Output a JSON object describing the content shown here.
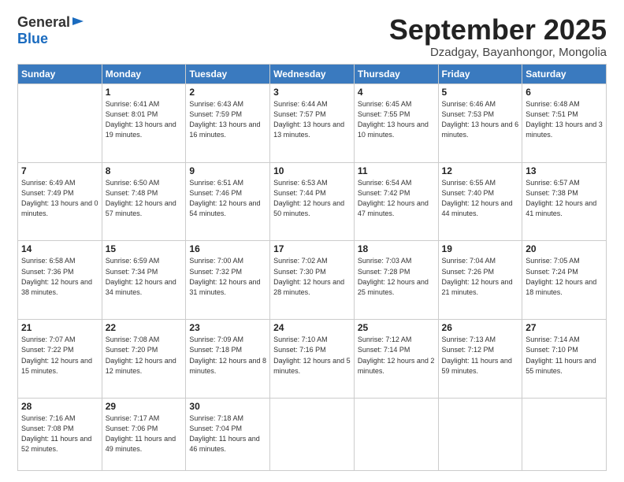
{
  "logo": {
    "general": "General",
    "blue": "Blue"
  },
  "header": {
    "month": "September 2025",
    "location": "Dzadgay, Bayanhongor, Mongolia"
  },
  "weekdays": [
    "Sunday",
    "Monday",
    "Tuesday",
    "Wednesday",
    "Thursday",
    "Friday",
    "Saturday"
  ],
  "weeks": [
    [
      {
        "day": "",
        "sunrise": "",
        "sunset": "",
        "daylight": ""
      },
      {
        "day": "1",
        "sunrise": "Sunrise: 6:41 AM",
        "sunset": "Sunset: 8:01 PM",
        "daylight": "Daylight: 13 hours and 19 minutes."
      },
      {
        "day": "2",
        "sunrise": "Sunrise: 6:43 AM",
        "sunset": "Sunset: 7:59 PM",
        "daylight": "Daylight: 13 hours and 16 minutes."
      },
      {
        "day": "3",
        "sunrise": "Sunrise: 6:44 AM",
        "sunset": "Sunset: 7:57 PM",
        "daylight": "Daylight: 13 hours and 13 minutes."
      },
      {
        "day": "4",
        "sunrise": "Sunrise: 6:45 AM",
        "sunset": "Sunset: 7:55 PM",
        "daylight": "Daylight: 13 hours and 10 minutes."
      },
      {
        "day": "5",
        "sunrise": "Sunrise: 6:46 AM",
        "sunset": "Sunset: 7:53 PM",
        "daylight": "Daylight: 13 hours and 6 minutes."
      },
      {
        "day": "6",
        "sunrise": "Sunrise: 6:48 AM",
        "sunset": "Sunset: 7:51 PM",
        "daylight": "Daylight: 13 hours and 3 minutes."
      }
    ],
    [
      {
        "day": "7",
        "sunrise": "Sunrise: 6:49 AM",
        "sunset": "Sunset: 7:49 PM",
        "daylight": "Daylight: 13 hours and 0 minutes."
      },
      {
        "day": "8",
        "sunrise": "Sunrise: 6:50 AM",
        "sunset": "Sunset: 7:48 PM",
        "daylight": "Daylight: 12 hours and 57 minutes."
      },
      {
        "day": "9",
        "sunrise": "Sunrise: 6:51 AM",
        "sunset": "Sunset: 7:46 PM",
        "daylight": "Daylight: 12 hours and 54 minutes."
      },
      {
        "day": "10",
        "sunrise": "Sunrise: 6:53 AM",
        "sunset": "Sunset: 7:44 PM",
        "daylight": "Daylight: 12 hours and 50 minutes."
      },
      {
        "day": "11",
        "sunrise": "Sunrise: 6:54 AM",
        "sunset": "Sunset: 7:42 PM",
        "daylight": "Daylight: 12 hours and 47 minutes."
      },
      {
        "day": "12",
        "sunrise": "Sunrise: 6:55 AM",
        "sunset": "Sunset: 7:40 PM",
        "daylight": "Daylight: 12 hours and 44 minutes."
      },
      {
        "day": "13",
        "sunrise": "Sunrise: 6:57 AM",
        "sunset": "Sunset: 7:38 PM",
        "daylight": "Daylight: 12 hours and 41 minutes."
      }
    ],
    [
      {
        "day": "14",
        "sunrise": "Sunrise: 6:58 AM",
        "sunset": "Sunset: 7:36 PM",
        "daylight": "Daylight: 12 hours and 38 minutes."
      },
      {
        "day": "15",
        "sunrise": "Sunrise: 6:59 AM",
        "sunset": "Sunset: 7:34 PM",
        "daylight": "Daylight: 12 hours and 34 minutes."
      },
      {
        "day": "16",
        "sunrise": "Sunrise: 7:00 AM",
        "sunset": "Sunset: 7:32 PM",
        "daylight": "Daylight: 12 hours and 31 minutes."
      },
      {
        "day": "17",
        "sunrise": "Sunrise: 7:02 AM",
        "sunset": "Sunset: 7:30 PM",
        "daylight": "Daylight: 12 hours and 28 minutes."
      },
      {
        "day": "18",
        "sunrise": "Sunrise: 7:03 AM",
        "sunset": "Sunset: 7:28 PM",
        "daylight": "Daylight: 12 hours and 25 minutes."
      },
      {
        "day": "19",
        "sunrise": "Sunrise: 7:04 AM",
        "sunset": "Sunset: 7:26 PM",
        "daylight": "Daylight: 12 hours and 21 minutes."
      },
      {
        "day": "20",
        "sunrise": "Sunrise: 7:05 AM",
        "sunset": "Sunset: 7:24 PM",
        "daylight": "Daylight: 12 hours and 18 minutes."
      }
    ],
    [
      {
        "day": "21",
        "sunrise": "Sunrise: 7:07 AM",
        "sunset": "Sunset: 7:22 PM",
        "daylight": "Daylight: 12 hours and 15 minutes."
      },
      {
        "day": "22",
        "sunrise": "Sunrise: 7:08 AM",
        "sunset": "Sunset: 7:20 PM",
        "daylight": "Daylight: 12 hours and 12 minutes."
      },
      {
        "day": "23",
        "sunrise": "Sunrise: 7:09 AM",
        "sunset": "Sunset: 7:18 PM",
        "daylight": "Daylight: 12 hours and 8 minutes."
      },
      {
        "day": "24",
        "sunrise": "Sunrise: 7:10 AM",
        "sunset": "Sunset: 7:16 PM",
        "daylight": "Daylight: 12 hours and 5 minutes."
      },
      {
        "day": "25",
        "sunrise": "Sunrise: 7:12 AM",
        "sunset": "Sunset: 7:14 PM",
        "daylight": "Daylight: 12 hours and 2 minutes."
      },
      {
        "day": "26",
        "sunrise": "Sunrise: 7:13 AM",
        "sunset": "Sunset: 7:12 PM",
        "daylight": "Daylight: 11 hours and 59 minutes."
      },
      {
        "day": "27",
        "sunrise": "Sunrise: 7:14 AM",
        "sunset": "Sunset: 7:10 PM",
        "daylight": "Daylight: 11 hours and 55 minutes."
      }
    ],
    [
      {
        "day": "28",
        "sunrise": "Sunrise: 7:16 AM",
        "sunset": "Sunset: 7:08 PM",
        "daylight": "Daylight: 11 hours and 52 minutes."
      },
      {
        "day": "29",
        "sunrise": "Sunrise: 7:17 AM",
        "sunset": "Sunset: 7:06 PM",
        "daylight": "Daylight: 11 hours and 49 minutes."
      },
      {
        "day": "30",
        "sunrise": "Sunrise: 7:18 AM",
        "sunset": "Sunset: 7:04 PM",
        "daylight": "Daylight: 11 hours and 46 minutes."
      },
      {
        "day": "",
        "sunrise": "",
        "sunset": "",
        "daylight": ""
      },
      {
        "day": "",
        "sunrise": "",
        "sunset": "",
        "daylight": ""
      },
      {
        "day": "",
        "sunrise": "",
        "sunset": "",
        "daylight": ""
      },
      {
        "day": "",
        "sunrise": "",
        "sunset": "",
        "daylight": ""
      }
    ]
  ]
}
